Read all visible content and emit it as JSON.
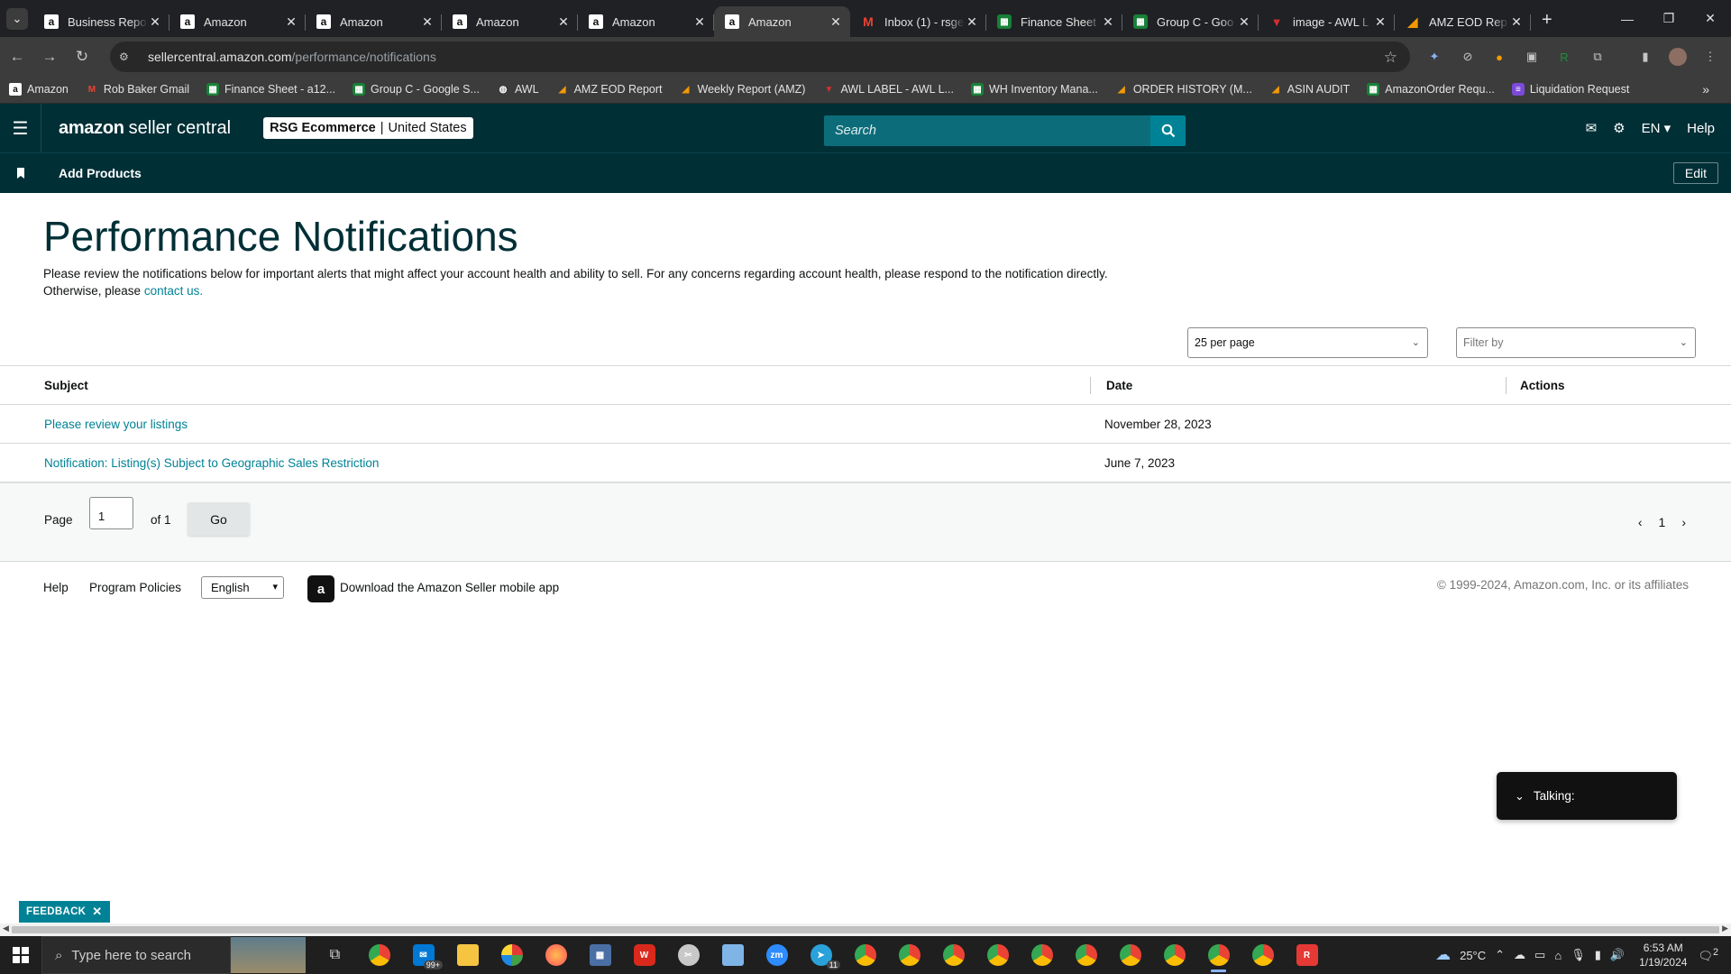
{
  "browser": {
    "tabs": [
      {
        "title": "Business Repor",
        "favicon": "amazon"
      },
      {
        "title": "Amazon",
        "favicon": "amazon"
      },
      {
        "title": "Amazon",
        "favicon": "amazon"
      },
      {
        "title": "Amazon",
        "favicon": "amazon"
      },
      {
        "title": "Amazon",
        "favicon": "amazon"
      },
      {
        "title": "Amazon",
        "favicon": "amazon",
        "active": true
      },
      {
        "title": "Inbox (1) - rsge",
        "favicon": "gmail"
      },
      {
        "title": "Finance Sheet",
        "favicon": "sheets"
      },
      {
        "title": "Group C - Goo",
        "favicon": "sheets"
      },
      {
        "title": "image - AWL L",
        "favicon": "awl"
      },
      {
        "title": "AMZ EOD Rep",
        "favicon": "amz"
      }
    ],
    "url_host": "sellercentral.amazon.com",
    "url_path": "/performance/notifications",
    "bookmarks": [
      {
        "label": "Amazon",
        "favicon": "amazon"
      },
      {
        "label": "Rob Baker Gmail",
        "favicon": "gmail"
      },
      {
        "label": "Finance Sheet - a12...",
        "favicon": "sheets"
      },
      {
        "label": "Group C - Google S...",
        "favicon": "sheets"
      },
      {
        "label": "AWL",
        "favicon": "awl-bm"
      },
      {
        "label": "AMZ EOD Report",
        "favicon": "amz"
      },
      {
        "label": "Weekly Report (AMZ)",
        "favicon": "amz"
      },
      {
        "label": "AWL LABEL - AWL L...",
        "favicon": "awl"
      },
      {
        "label": "WH Inventory Mana...",
        "favicon": "sheets"
      },
      {
        "label": "ORDER HISTORY (M...",
        "favicon": "amz"
      },
      {
        "label": "ASIN AUDIT",
        "favicon": "amz"
      },
      {
        "label": "AmazonOrder Requ...",
        "favicon": "sheets"
      },
      {
        "label": "Liquidation Request",
        "favicon": "list"
      }
    ]
  },
  "header": {
    "logo_brand": "amazon",
    "logo_product": "seller central",
    "account_name": "RSG Ecommerce",
    "account_region": "United States",
    "search_placeholder": "Search",
    "language": "EN",
    "help": "Help"
  },
  "subnav": {
    "add_products": "Add Products",
    "edit": "Edit"
  },
  "page": {
    "title": "Performance Notifications",
    "intro": "Please review the notifications below for important alerts that might affect your account health and ability to sell. For any concerns regarding account health, please respond to the notification directly. Otherwise, please",
    "contact_link": "contact us.",
    "per_page": "25 per page",
    "filter_placeholder": "Filter by"
  },
  "table": {
    "columns": [
      "Subject",
      "Date",
      "Actions"
    ],
    "rows": [
      {
        "subject": "Please review your listings",
        "date": "November 28, 2023",
        "actions": ""
      },
      {
        "subject": "Notification: Listing(s) Subject to Geographic Sales Restriction",
        "date": "June 7, 2023",
        "actions": ""
      }
    ]
  },
  "pagination": {
    "page_label": "Page",
    "page_value": "1",
    "of_label": "of 1",
    "go": "Go",
    "current_page": "1"
  },
  "footer": {
    "help": "Help",
    "program_policies": "Program Policies",
    "language": "English",
    "download_app": "Download the Amazon Seller mobile app",
    "copyright": "© 1999-2024, Amazon.com, Inc. or its affiliates"
  },
  "widgets": {
    "talking": "Talking:",
    "feedback": "FEEDBACK"
  },
  "taskbar": {
    "search_placeholder": "Type here to search",
    "mail_badge": "99+",
    "telegram_badge": "11",
    "temperature": "25°C",
    "time": "6:53 AM",
    "date": "1/19/2024",
    "notification_count": "2"
  },
  "colors": {
    "sc_header": "#002f36",
    "accent_teal": "#008296",
    "link": "#008296"
  }
}
